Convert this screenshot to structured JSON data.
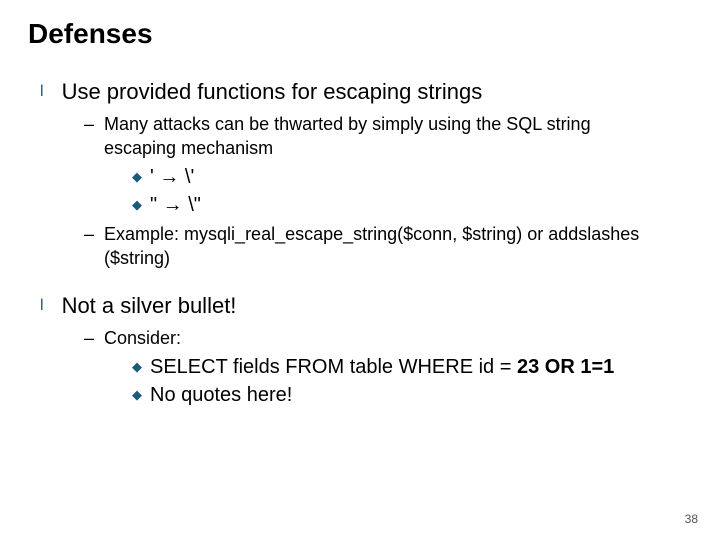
{
  "title": "Defenses",
  "section1": {
    "main": "Use provided functions for escaping strings",
    "sub1": "Many attacks can be thwarted by simply using the SQL string escaping mechanism",
    "escape1": "'  →  \\'",
    "escape2": "\"  →  \\\"",
    "sub2": "Example:   mysqli_real_escape_string($conn, $string) or addslashes ($string)"
  },
  "section2": {
    "main": "Not a silver bullet!",
    "sub1": "Consider:",
    "query_prefix": "SELECT",
    "query_mid": " fields FROM table WHERE id = ",
    "query_bold": "23 OR 1=1",
    "noq_prefix": "No",
    "noq_rest": " quotes here!"
  },
  "pagenum": "38"
}
